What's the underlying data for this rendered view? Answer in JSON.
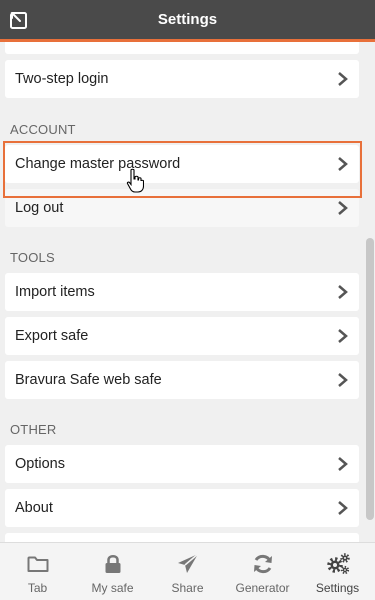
{
  "header": {
    "title": "Settings"
  },
  "security": {
    "items": [
      {
        "label": "Two-step login"
      }
    ]
  },
  "account": {
    "heading": "ACCOUNT",
    "items": [
      {
        "label": "Change master password"
      },
      {
        "label": "Log out"
      }
    ]
  },
  "tools": {
    "heading": "TOOLS",
    "items": [
      {
        "label": "Import items"
      },
      {
        "label": "Export safe"
      },
      {
        "label": "Bravura Safe web safe"
      }
    ]
  },
  "other": {
    "heading": "OTHER",
    "items": [
      {
        "label": "Options"
      },
      {
        "label": "About"
      }
    ]
  },
  "tabbar": {
    "active": "Settings",
    "tabs": [
      {
        "label": "Tab",
        "icon": "folder-icon"
      },
      {
        "label": "My safe",
        "icon": "lock-icon"
      },
      {
        "label": "Share",
        "icon": "send-icon"
      },
      {
        "label": "Generator",
        "icon": "refresh-icon"
      },
      {
        "label": "Settings",
        "icon": "gears-icon"
      }
    ]
  },
  "colors": {
    "header_bg": "#4a4a4a",
    "accent": "#e8703a",
    "background": "#f0f0f0"
  }
}
